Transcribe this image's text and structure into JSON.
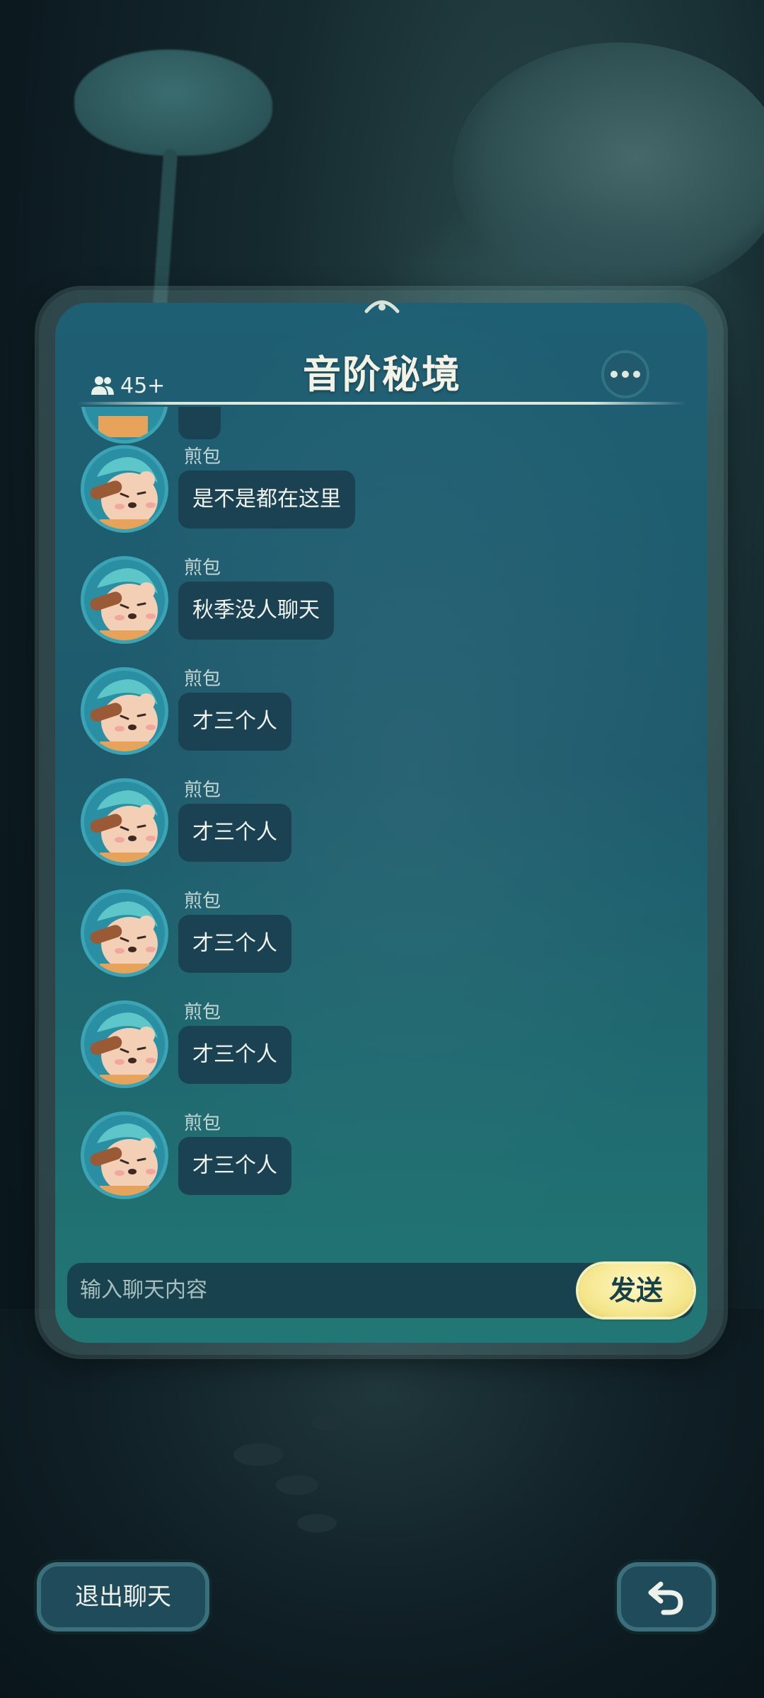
{
  "header": {
    "online_count": "45+",
    "title": "音阶秘境"
  },
  "messages": [
    {
      "sender": "煎包",
      "text": "是不是都在这里"
    },
    {
      "sender": "煎包",
      "text": "秋季没人聊天"
    },
    {
      "sender": "煎包",
      "text": "才三个人"
    },
    {
      "sender": "煎包",
      "text": "才三个人"
    },
    {
      "sender": "煎包",
      "text": "才三个人"
    },
    {
      "sender": "煎包",
      "text": "才三个人"
    },
    {
      "sender": "煎包",
      "text": "才三个人"
    }
  ],
  "input": {
    "placeholder": "输入聊天内容",
    "send_label": "发送"
  },
  "footer": {
    "exit_label": "退出聊天"
  },
  "colors": {
    "panel": "#1f5f73",
    "bubble": "#1a4253",
    "send_button": "#f4e58a"
  }
}
